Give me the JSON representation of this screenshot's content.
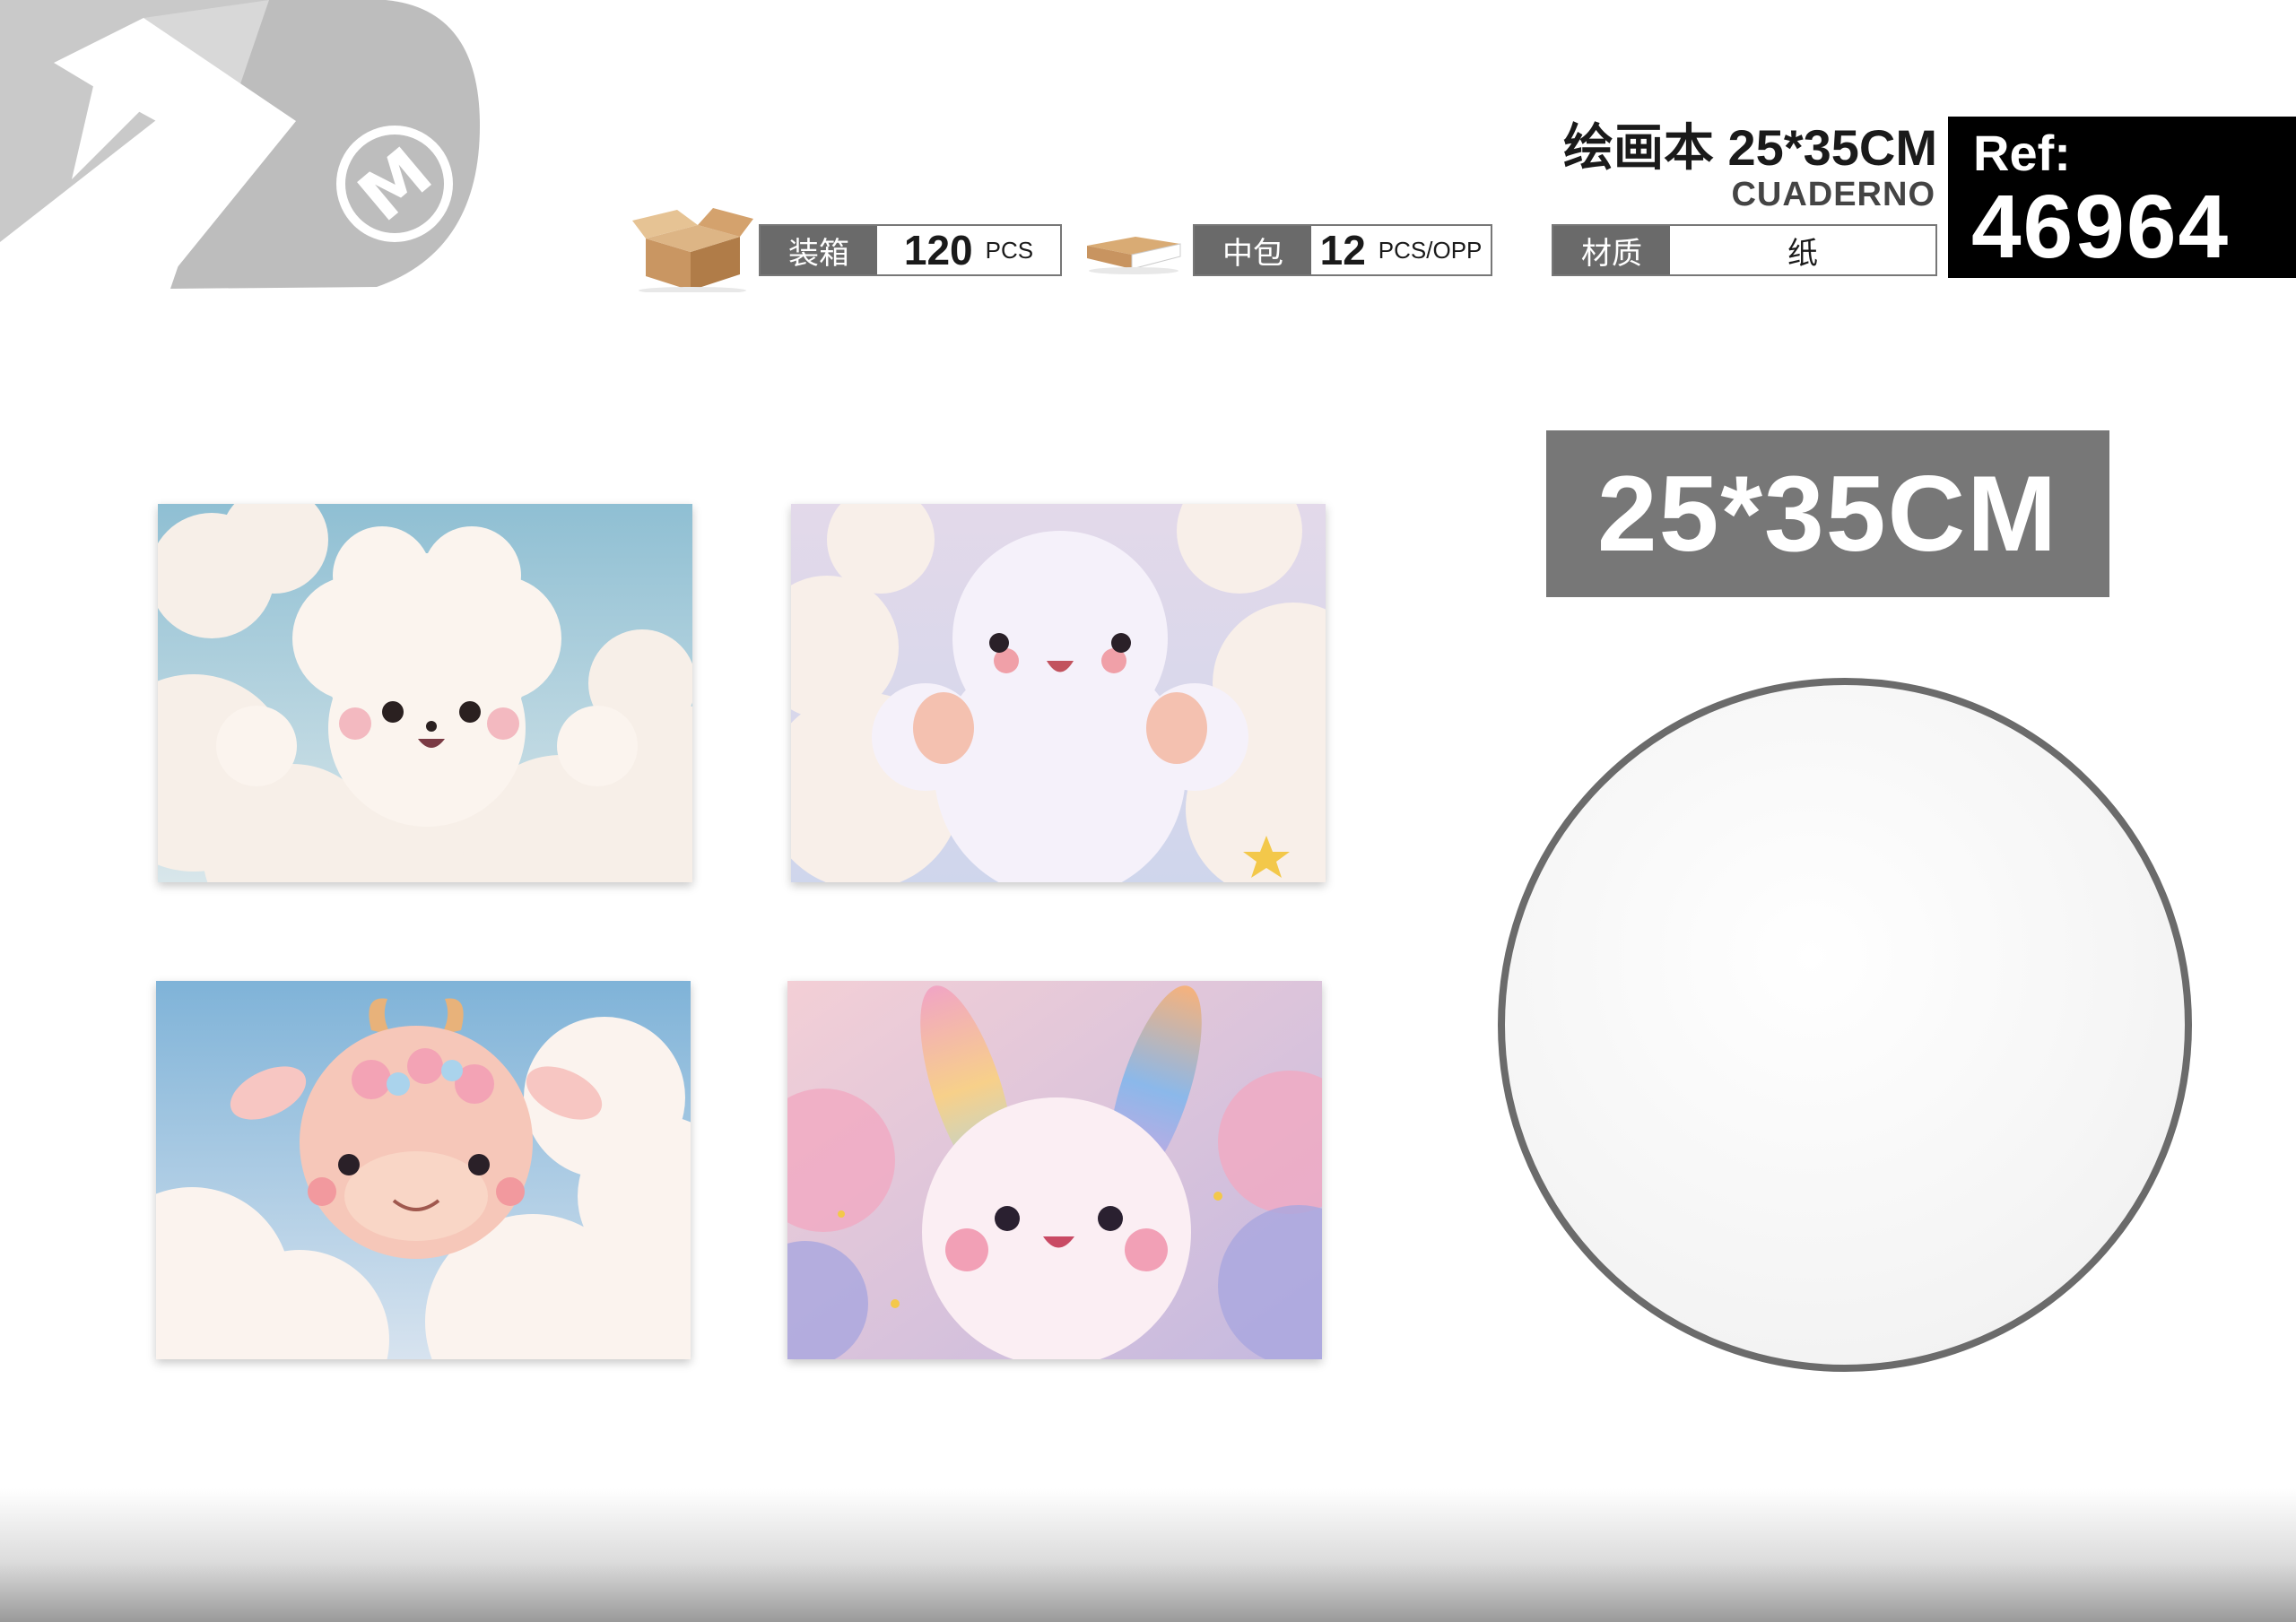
{
  "header": {
    "title_cn": "绘画本 25*35CM",
    "title_es": "CUADERNO",
    "ref_label": "Ref:",
    "ref_number": "46964"
  },
  "specs": {
    "carton": {
      "icon": "carton-box-icon",
      "label": "装箱",
      "value": "120",
      "unit": "PCS"
    },
    "inner_pack": {
      "icon": "tray-box-icon",
      "label": "中包",
      "value": "12",
      "unit": "PCS/OPP"
    },
    "material": {
      "label": "材质",
      "value": "纸"
    }
  },
  "size_banner": "25*35CM",
  "logo": {
    "icon": "brand-m-logo"
  },
  "notebooks": [
    {
      "subject": "cloud-bear",
      "sky": "#9cc3d6"
    },
    {
      "subject": "fluffy-cat",
      "sky": "#d7d4e8"
    },
    {
      "subject": "pink-calf",
      "sky": "#8fb9d8"
    },
    {
      "subject": "rainbow-bunny",
      "sky": "#e6bfd6"
    }
  ],
  "colors": {
    "accent_gray": "#777777",
    "ref_bg": "#000000"
  }
}
